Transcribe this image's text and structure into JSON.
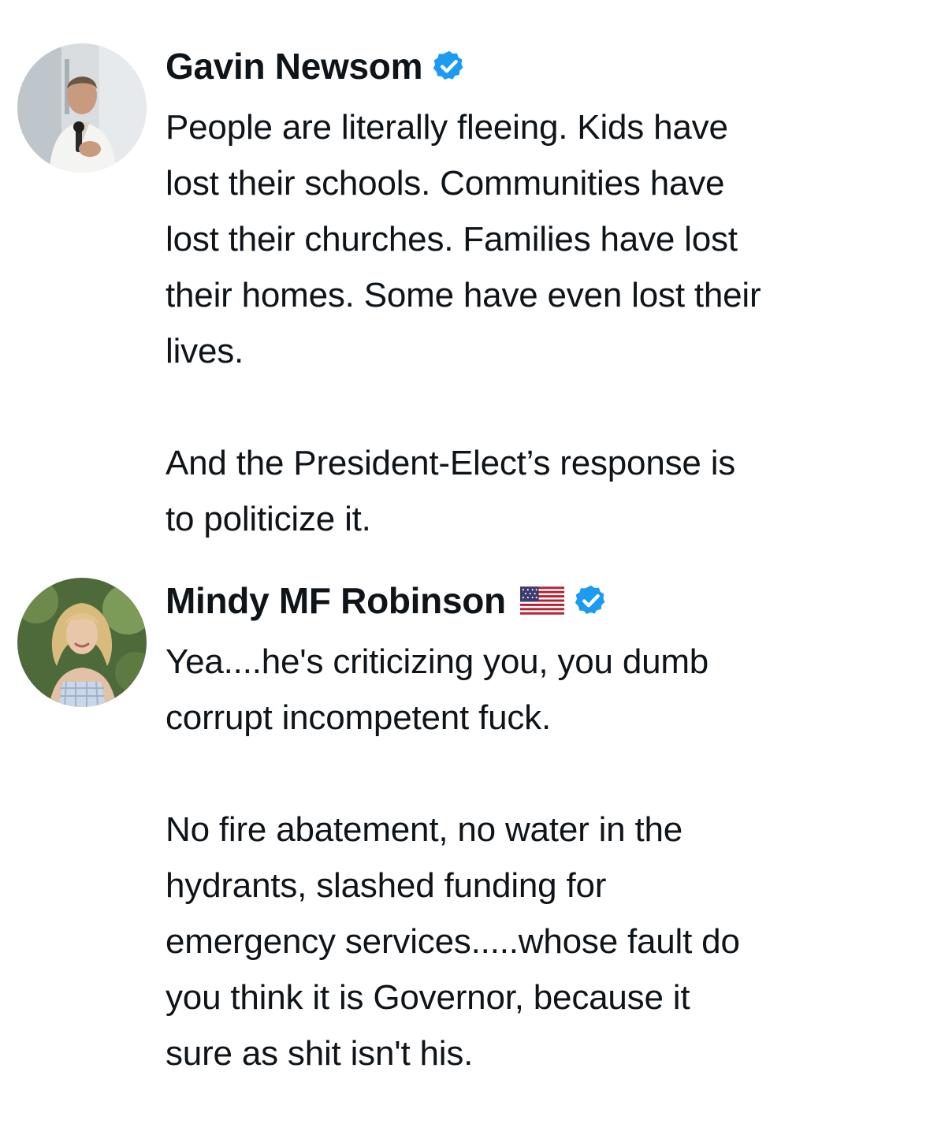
{
  "posts": [
    {
      "author": "Gavin Newsom",
      "verified": true,
      "avatar_icon": "profile-photo-man-with-microphone",
      "paragraphs": [
        "People are literally fleeing. Kids have\nlost their schools. Communities have\nlost their churches. Families have lost\ntheir homes. Some have even lost their\nlives.",
        "And the President-Elect’s response is\nto politicize it."
      ]
    },
    {
      "author": "Mindy MF Robinson",
      "verified": true,
      "flag_icon": "us-flag-emoji",
      "avatar_icon": "profile-photo-woman-curly-blonde-hair",
      "paragraphs": [
        "Yea....he's criticizing you, you dumb\ncorrupt incompetent fuck.",
        "No fire abatement, no water in the\nhydrants, slashed funding for\nemergency services.....whose fault do\nyou think it is Governor, because it\nsure as shit isn't his."
      ]
    }
  ],
  "colors": {
    "verified_badge": "#1d9bf0",
    "text": "#0f1419",
    "background": "#ffffff"
  }
}
